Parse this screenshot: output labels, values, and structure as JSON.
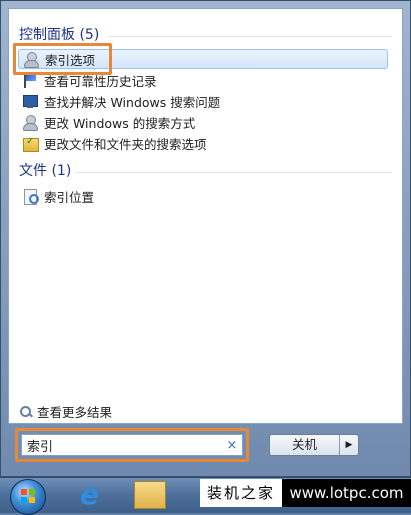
{
  "results": {
    "groups": [
      {
        "header": "控制面板 (5)",
        "items": [
          {
            "label": "索引选项",
            "icon": "user-icon",
            "selected": true
          },
          {
            "label": "查看可靠性历史记录",
            "icon": "flag-icon"
          },
          {
            "label": "查找并解决 Windows 搜索问题",
            "icon": "monitor-icon"
          },
          {
            "label": "更改 Windows 的搜索方式",
            "icon": "user-icon"
          },
          {
            "label": "更改文件和文件夹的搜索选项",
            "icon": "folder-options-icon"
          }
        ]
      },
      {
        "header": "文件 (1)",
        "items": [
          {
            "label": "索引位置",
            "icon": "index-icon"
          }
        ]
      }
    ],
    "see_more": "查看更多结果"
  },
  "search": {
    "value": "索引",
    "clear_glyph": "×"
  },
  "shutdown": {
    "label": "关机",
    "arrow_glyph": "▶"
  },
  "taskbar": {
    "items": [
      "start-orb",
      "ie-icon",
      "explorer-icon"
    ]
  },
  "watermark": {
    "name": "装机之家",
    "url": "www.lotpc.com"
  },
  "colors": {
    "highlight": "#e6873a",
    "header_text": "#1e3287",
    "selection": "#d3e6fa"
  }
}
